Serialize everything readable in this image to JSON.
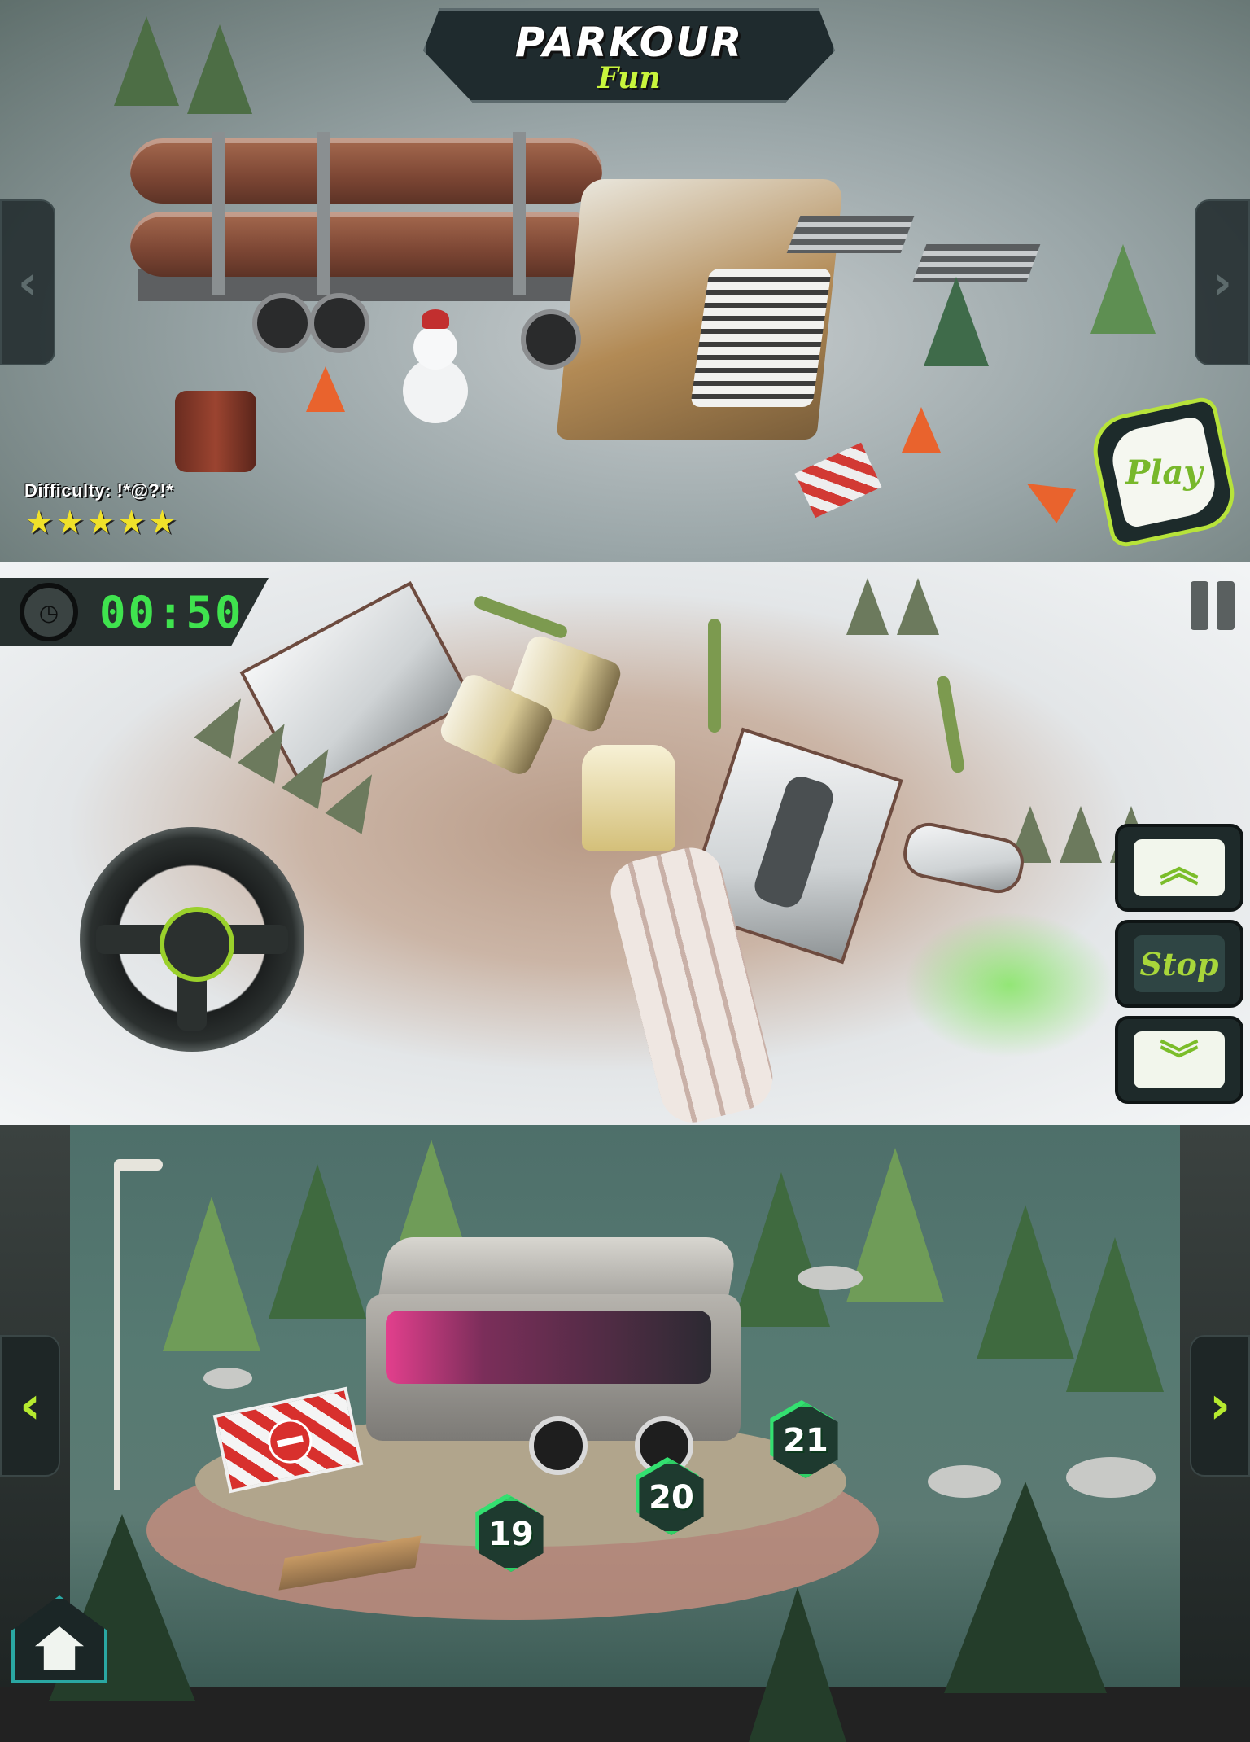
{
  "panel1": {
    "logo": {
      "title": "PARKOUR",
      "subtitle": "Fun"
    },
    "difficulty_text": "Difficulty: !*@?!*",
    "stars": [
      "★",
      "★",
      "★",
      "★",
      "★"
    ],
    "play_label": "Play",
    "nav_left_icon": "chevron-left-icon",
    "nav_right_icon": "chevron-right-icon",
    "chevron_left": "‹",
    "chevron_right": "›"
  },
  "panel2": {
    "timer": "00:50",
    "stopwatch_icon": "◷",
    "controls": {
      "accelerate_icon": "︽",
      "stop_label": "Stop",
      "reverse_icon": "︾"
    }
  },
  "panel3": {
    "levels": [
      {
        "number": "19"
      },
      {
        "number": "20"
      },
      {
        "number": "21"
      }
    ],
    "chevron_left": "‹",
    "chevron_right": "›"
  },
  "colors": {
    "accent_green": "#b7e33a",
    "timer_green": "#3fe34e",
    "level_green": "#2ed065",
    "star_yellow": "#f0e12a"
  }
}
